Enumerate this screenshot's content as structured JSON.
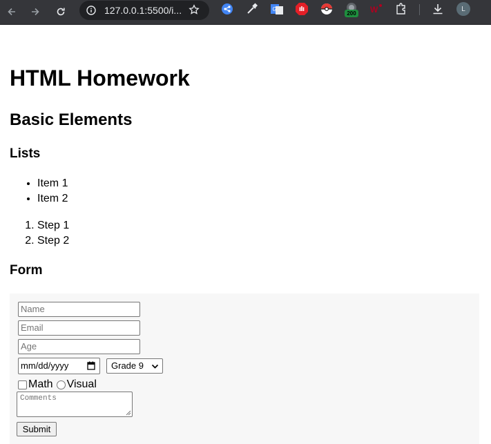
{
  "browser": {
    "url": "127.0.0.1:5500/i...",
    "profile_initial": "L",
    "extension_badge": "200"
  },
  "page": {
    "title": "HTML Homework",
    "section_title": "Basic Elements",
    "lists_heading": "Lists",
    "unordered_items": [
      "Item 1",
      "Item 2"
    ],
    "ordered_items": [
      "Step 1",
      "Step 2"
    ],
    "form_heading": "Form"
  },
  "form": {
    "name_placeholder": "Name",
    "email_placeholder": "Email",
    "age_placeholder": "Age",
    "date_placeholder": "mm/dd/yyyy",
    "grade_selected": "Grade 9",
    "checkbox_label": "Math",
    "radio_label": "Visual",
    "comments_placeholder": "Comments",
    "submit_label": "Submit"
  }
}
